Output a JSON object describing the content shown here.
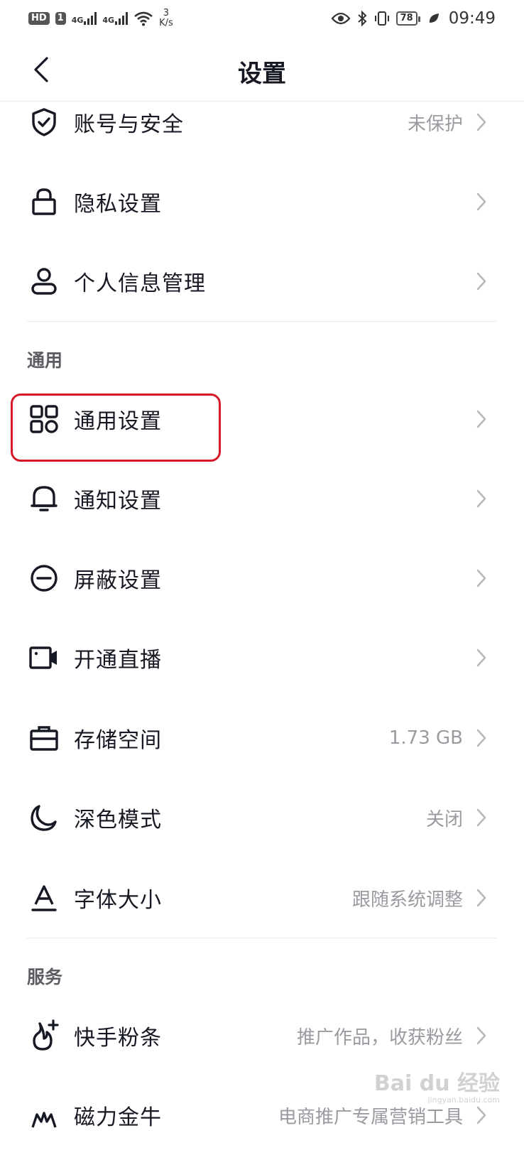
{
  "status_bar": {
    "hd_label": "HD",
    "sim_index": "1",
    "net1": "4G",
    "net2": "4G",
    "speed_value": "3",
    "speed_unit": "K/s",
    "battery": "78",
    "time": "09:49"
  },
  "header": {
    "title": "设置",
    "back_icon": "chevron-left-icon"
  },
  "sections": {
    "general_title": "通用",
    "service_title": "服务"
  },
  "rows": {
    "account": {
      "label": "账号与安全",
      "value": "未保护",
      "icon": "shield-check-icon"
    },
    "privacy": {
      "label": "隐私设置",
      "value": "",
      "icon": "lock-icon"
    },
    "personal": {
      "label": "个人信息管理",
      "value": "",
      "icon": "user-icon"
    },
    "general": {
      "label": "通用设置",
      "value": "",
      "icon": "apps-grid-icon"
    },
    "notify": {
      "label": "通知设置",
      "value": "",
      "icon": "bell-icon"
    },
    "block": {
      "label": "屏蔽设置",
      "value": "",
      "icon": "minus-circle-icon"
    },
    "live": {
      "label": "开通直播",
      "value": "",
      "icon": "video-camera-icon"
    },
    "storage": {
      "label": "存储空间",
      "value": "1.73 GB",
      "icon": "toolbox-icon"
    },
    "dark": {
      "label": "深色模式",
      "value": "关闭",
      "icon": "moon-icon"
    },
    "font": {
      "label": "字体大小",
      "value": "跟随系统调整",
      "icon": "font-size-icon"
    },
    "fans": {
      "label": "快手粉条",
      "value": "推广作品，收获粉丝",
      "icon": "fire-plus-icon"
    },
    "cili": {
      "label": "磁力金牛",
      "value": "电商推广专属营销工具",
      "icon": "magnet-icon"
    }
  },
  "watermark": {
    "text": "Bai du 经验",
    "sub": "jingyan.baidu.com"
  },
  "colors": {
    "text_primary": "#161823",
    "text_secondary": "#9a9ba1",
    "highlight_red": "#d8192a",
    "divider": "#ececec"
  }
}
